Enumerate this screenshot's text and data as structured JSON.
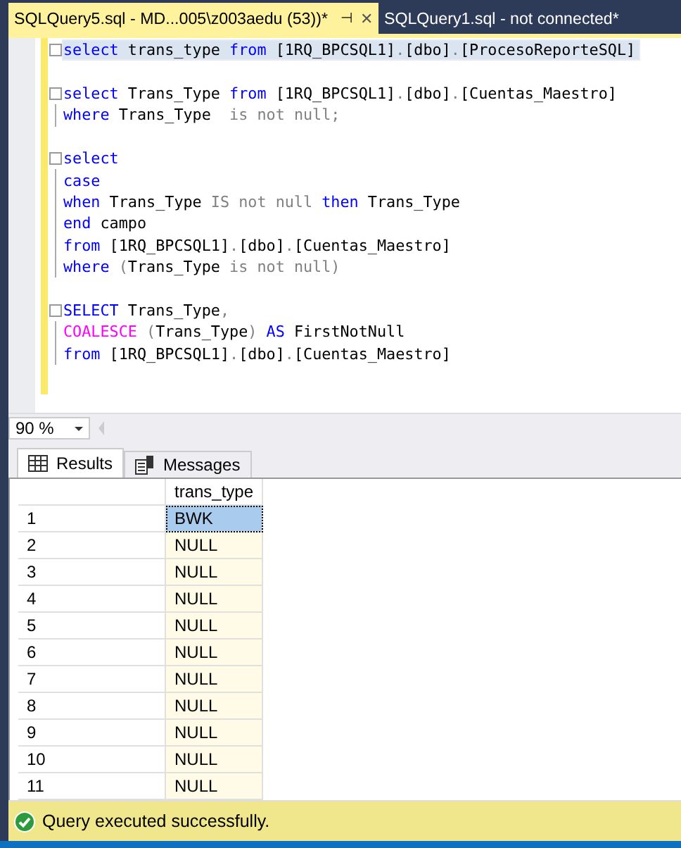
{
  "tabs": [
    {
      "label": "SQLQuery5.sql - MD...005\\z003aedu (53))*",
      "selected": true,
      "pin": "⊣",
      "close": "✕"
    },
    {
      "label": "SQLQuery1.sql - not connected*",
      "selected": false
    }
  ],
  "editor": {
    "blocks": [
      {
        "lines": [
          {
            "current": true,
            "segments": [
              {
                "text": "select",
                "color": "#0000ff"
              },
              {
                "text": " trans_type ",
                "color": "#000000"
              },
              {
                "text": "from",
                "color": "#0000ff"
              },
              {
                "text": " [1RQ_BPCSQL1]",
                "color": "#000000"
              },
              {
                "text": ".",
                "color": "#808080"
              },
              {
                "text": "[dbo]",
                "color": "#000000"
              },
              {
                "text": ".",
                "color": "#808080"
              },
              {
                "text": "[ProcesoReporteSQL]",
                "color": "#000000"
              }
            ]
          }
        ]
      },
      {
        "lines": [
          {
            "current": false,
            "segments": [
              {
                "text": "select",
                "color": "#0000ff"
              },
              {
                "text": " Trans_Type ",
                "color": "#000000"
              },
              {
                "text": "from",
                "color": "#0000ff"
              },
              {
                "text": " [1RQ_BPCSQL1]",
                "color": "#000000"
              },
              {
                "text": ".",
                "color": "#808080"
              },
              {
                "text": "[dbo]",
                "color": "#000000"
              },
              {
                "text": ".",
                "color": "#808080"
              },
              {
                "text": "[Cuentas_Maestro]",
                "color": "#000000"
              }
            ]
          },
          {
            "current": false,
            "segments": [
              {
                "text": "where",
                "color": "#0000ff"
              },
              {
                "text": " Trans_Type  ",
                "color": "#000000"
              },
              {
                "text": "is not null;",
                "color": "#808080"
              }
            ]
          }
        ]
      },
      {
        "lines": [
          {
            "current": false,
            "segments": [
              {
                "text": "select",
                "color": "#0000ff"
              }
            ]
          },
          {
            "current": false,
            "segments": [
              {
                "text": "case",
                "color": "#0000ff"
              }
            ]
          },
          {
            "current": false,
            "segments": [
              {
                "text": "when",
                "color": "#0000ff"
              },
              {
                "text": " Trans_Type ",
                "color": "#000000"
              },
              {
                "text": "IS not null",
                "color": "#808080"
              },
              {
                "text": " then",
                "color": "#0000ff"
              },
              {
                "text": " Trans_Type",
                "color": "#000000"
              }
            ]
          },
          {
            "current": false,
            "segments": [
              {
                "text": "end",
                "color": "#0000ff"
              },
              {
                "text": " campo",
                "color": "#000000"
              }
            ]
          },
          {
            "current": false,
            "segments": [
              {
                "text": "from",
                "color": "#0000ff"
              },
              {
                "text": " [1RQ_BPCSQL1]",
                "color": "#000000"
              },
              {
                "text": ".",
                "color": "#808080"
              },
              {
                "text": "[dbo]",
                "color": "#000000"
              },
              {
                "text": ".",
                "color": "#808080"
              },
              {
                "text": "[Cuentas_Maestro]",
                "color": "#000000"
              }
            ]
          },
          {
            "current": false,
            "segments": [
              {
                "text": "where",
                "color": "#0000ff"
              },
              {
                "text": " (",
                "color": "#808080"
              },
              {
                "text": "Trans_Type ",
                "color": "#000000"
              },
              {
                "text": "is not null)",
                "color": "#808080"
              }
            ]
          }
        ]
      },
      {
        "lines": [
          {
            "current": false,
            "segments": [
              {
                "text": "SELECT",
                "color": "#0000ff"
              },
              {
                "text": " Trans_Type",
                "color": "#000000"
              },
              {
                "text": ",",
                "color": "#808080"
              }
            ]
          },
          {
            "current": false,
            "segments": [
              {
                "text": "COALESCE",
                "color": "#ff00ff"
              },
              {
                "text": " (",
                "color": "#808080"
              },
              {
                "text": "Trans_Type",
                "color": "#000000"
              },
              {
                "text": ")",
                "color": "#808080"
              },
              {
                "text": " AS",
                "color": "#0000ff"
              },
              {
                "text": " FirstNotNull",
                "color": "#000000"
              }
            ]
          },
          {
            "current": false,
            "segments": [
              {
                "text": "from",
                "color": "#0000ff"
              },
              {
                "text": " [1RQ_BPCSQL1]",
                "color": "#000000"
              },
              {
                "text": ".",
                "color": "#808080"
              },
              {
                "text": "[dbo]",
                "color": "#000000"
              },
              {
                "text": ".",
                "color": "#808080"
              },
              {
                "text": "[Cuentas_Maestro]",
                "color": "#000000"
              }
            ]
          }
        ]
      }
    ]
  },
  "zoom": {
    "value": "90 %"
  },
  "result_tabs": [
    {
      "label": "Results",
      "kind": "grid",
      "selected": true
    },
    {
      "label": "Messages",
      "kind": "messages",
      "selected": false
    }
  ],
  "grid": {
    "columns": [
      "trans_type"
    ],
    "rows": [
      {
        "num": "1",
        "value": "BWK",
        "selected": true
      },
      {
        "num": "2",
        "value": "NULL",
        "selected": false
      },
      {
        "num": "3",
        "value": "NULL",
        "selected": false
      },
      {
        "num": "4",
        "value": "NULL",
        "selected": false
      },
      {
        "num": "5",
        "value": "NULL",
        "selected": false
      },
      {
        "num": "6",
        "value": "NULL",
        "selected": false
      },
      {
        "num": "7",
        "value": "NULL",
        "selected": false
      },
      {
        "num": "8",
        "value": "NULL",
        "selected": false
      },
      {
        "num": "9",
        "value": "NULL",
        "selected": false
      },
      {
        "num": "10",
        "value": "NULL",
        "selected": false
      },
      {
        "num": "11",
        "value": "NULL",
        "selected": false
      }
    ]
  },
  "status_bar": {
    "text": "Query executed successfully."
  }
}
